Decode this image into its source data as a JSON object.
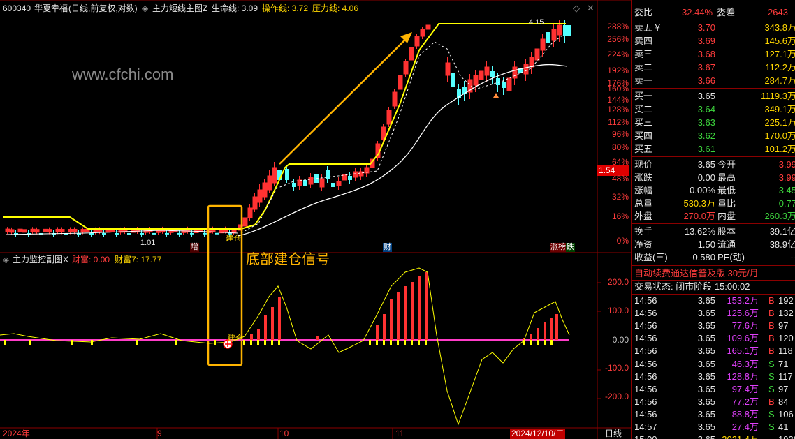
{
  "header": {
    "symbol": "600340",
    "name": "华夏幸福",
    "mode": "(日线,前复权,对数)",
    "indicator_name": "主力短线主图Z",
    "lifeline": "生命线: 3.09",
    "operation": "操作线: 3.72",
    "pressure": "压力线: 4.06"
  },
  "watermark": "www.cfchi.com",
  "annotation": "底部建仓信号",
  "main_price_axis": [
    "288%",
    "256%",
    "224%",
    "192%",
    "176%",
    "160%",
    "144%",
    "128%",
    "112%",
    "96%",
    "80%",
    "64%",
    "48%",
    "32%",
    "16%",
    "0%"
  ],
  "current_price_tag": "1.54",
  "price_labels": {
    "high": "4.15",
    "low": "1.01"
  },
  "event_markers": {
    "zeng": "增",
    "jiancang": "建仓",
    "cai": "财",
    "zhangbang": "涨榜",
    "die": "跌"
  },
  "sub_header": {
    "name": "主力监控副图X",
    "caifu": "财富: 0.00",
    "caifu7": "财富7: 17.77"
  },
  "sub_axis": [
    "200.0",
    "100.0",
    "0.00",
    "-100.0",
    "-200.0"
  ],
  "sub_marker": "建仓",
  "time_axis": [
    "2024年",
    "9",
    "10",
    "11"
  ],
  "date_tag": "2024/12/10/二",
  "period_button": "日线",
  "chart_data": {
    "type": "candlestick",
    "price_labels": {
      "high": 4.15,
      "low": 1.01
    },
    "lifeline": 3.09,
    "operation_line": 3.72,
    "pressure_line": 4.06,
    "sub_indicator": {
      "caifu": 0.0,
      "caifu7": 17.77,
      "ylim": [
        -200,
        200
      ]
    }
  },
  "orderbook": {
    "weibi_label": "委比",
    "weibi_value": "32.44%",
    "weicha_label": "委差",
    "weicha_value": "2643",
    "asks": [
      {
        "label": "卖五 ¥",
        "price": "3.70",
        "vol": "343.8万"
      },
      {
        "label": "卖四",
        "price": "3.69",
        "vol": "145.6万"
      },
      {
        "label": "卖三",
        "price": "3.68",
        "vol": "127.1万"
      },
      {
        "label": "卖二",
        "price": "3.67",
        "vol": "112.2万"
      },
      {
        "label": "卖一",
        "price": "3.66",
        "vol": "284.7万"
      }
    ],
    "bids": [
      {
        "label": "买一",
        "price": "3.65",
        "vol": "1119.3万"
      },
      {
        "label": "买二",
        "price": "3.64",
        "vol": "349.1万"
      },
      {
        "label": "买三",
        "price": "3.63",
        "vol": "225.1万"
      },
      {
        "label": "买四",
        "price": "3.62",
        "vol": "170.0万"
      },
      {
        "label": "买五",
        "price": "3.61",
        "vol": "101.2万"
      }
    ]
  },
  "quote": [
    {
      "l1": "现价",
      "v1": "3.65",
      "l2": "今开",
      "v2": "3.99"
    },
    {
      "l1": "涨跌",
      "v1": "0.00",
      "l2": "最高",
      "v2": "3.99"
    },
    {
      "l1": "涨幅",
      "v1": "0.00%",
      "l2": "最低",
      "v2": "3.45"
    },
    {
      "l1": "总量",
      "v1": "530.3万",
      "l2": "量比",
      "v2": "0.77"
    },
    {
      "l1": "外盘",
      "v1": "270.0万",
      "l2": "内盘",
      "v2": "260.3万"
    }
  ],
  "fundamentals": [
    {
      "l1": "换手",
      "v1": "13.62%",
      "l2": "股本",
      "v2": "39.1亿"
    },
    {
      "l1": "净资",
      "v1": "1.50",
      "l2": "流通",
      "v2": "38.9亿"
    },
    {
      "l1": "收益(三)",
      "v1": "-0.580",
      "l2": "PE(动)",
      "v2": "--"
    }
  ],
  "promo": "自动续费通达信普及版  30元/月",
  "trade_status": "交易状态: 闭市阶段 15:00:02",
  "ticks": [
    {
      "t": "14:56",
      "p": "3.65",
      "v": "153.2万",
      "s": "B",
      "n": "192"
    },
    {
      "t": "14:56",
      "p": "3.65",
      "v": "125.6万",
      "s": "B",
      "n": "132"
    },
    {
      "t": "14:56",
      "p": "3.65",
      "v": "77.6万",
      "s": "B",
      "n": "97"
    },
    {
      "t": "14:56",
      "p": "3.65",
      "v": "109.6万",
      "s": "B",
      "n": "120"
    },
    {
      "t": "14:56",
      "p": "3.65",
      "v": "165.1万",
      "s": "B",
      "n": "118"
    },
    {
      "t": "14:56",
      "p": "3.65",
      "v": "46.3万",
      "s": "S",
      "n": "71"
    },
    {
      "t": "14:56",
      "p": "3.65",
      "v": "128.8万",
      "s": "S",
      "n": "117"
    },
    {
      "t": "14:56",
      "p": "3.65",
      "v": "97.4万",
      "s": "S",
      "n": "97"
    },
    {
      "t": "14:56",
      "p": "3.65",
      "v": "77.2万",
      "s": "B",
      "n": "84"
    },
    {
      "t": "14:56",
      "p": "3.65",
      "v": "88.8万",
      "s": "S",
      "n": "106"
    },
    {
      "t": "14:57",
      "p": "3.65",
      "v": "27.4万",
      "s": "S",
      "n": "41"
    },
    {
      "t": "15:00",
      "p": "3.65",
      "v": "2021.4万",
      "s": "",
      "n": "1938"
    }
  ],
  "colors": {
    "up": "#ff3232",
    "down": "#54ffff",
    "pressure": "#ffff00",
    "accent": "#ffb400"
  }
}
